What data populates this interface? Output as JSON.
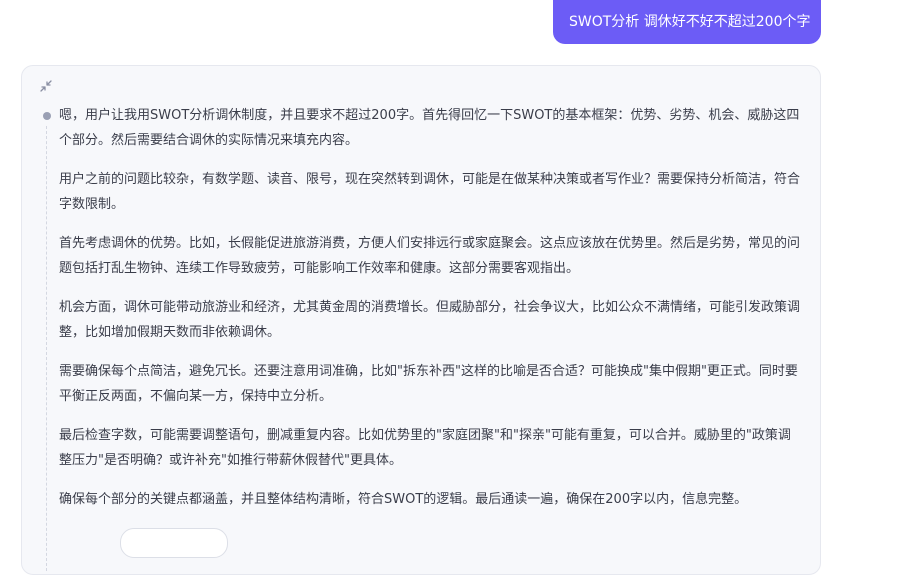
{
  "user_message": {
    "text": "SWOT分析 调休好不好不超过200个字"
  },
  "thinking": {
    "collapse_icon": "collapse-arrows-icon",
    "paragraphs": [
      "嗯，用户让我用SWOT分析调休制度，并且要求不超过200字。首先得回忆一下SWOT的基本框架：优势、劣势、机会、威胁这四个部分。然后需要结合调休的实际情况来填充内容。",
      "用户之前的问题比较杂，有数学题、读音、限号，现在突然转到调休，可能是在做某种决策或者写作业？需要保持分析简洁，符合字数限制。",
      "首先考虑调休的优势。比如，长假能促进旅游消费，方便人们安排远行或家庭聚会。这点应该放在优势里。然后是劣势，常见的问题包括打乱生物钟、连续工作导致疲劳，可能影响工作效率和健康。这部分需要客观指出。",
      "机会方面，调休可能带动旅游业和经济，尤其黄金周的消费增长。但威胁部分，社会争议大，比如公众不满情绪，可能引发政策调整，比如增加假期天数而非依赖调休。",
      "需要确保每个点简洁，避免冗长。还要注意用词准确，比如\"拆东补西\"这样的比喻是否合适？可能换成\"集中假期\"更正式。同时要平衡正反两面，不偏向某一方，保持中立分析。",
      "最后检查字数，可能需要调整语句，删减重复内容。比如优势里的\"家庭团聚\"和\"探亲\"可能有重复，可以合并。威胁里的\"政策调整压力\"是否明确？或许补充\"如推行带薪休假替代\"更具体。",
      "确保每个部分的关键点都涵盖，并且整体结构清晰，符合SWOT的逻辑。最后通读一遍，确保在200字以内，信息完整。"
    ]
  },
  "colors": {
    "accent": "#6c5cf6",
    "panel_bg": "#f7f8fb",
    "text": "#3a3d4a"
  }
}
